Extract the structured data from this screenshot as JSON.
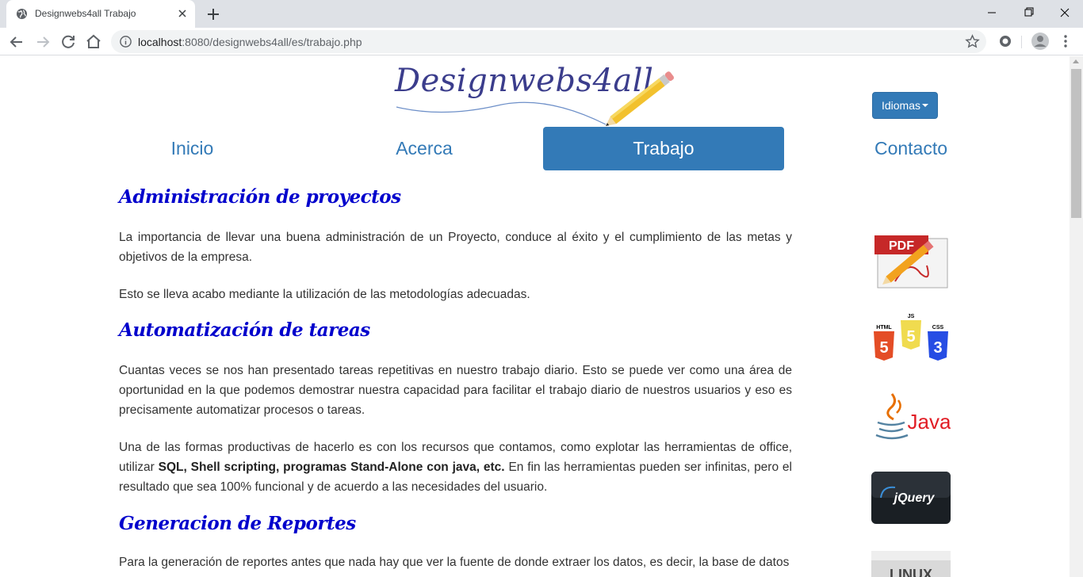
{
  "browser": {
    "tab_title": "Designwebs4all Trabajo",
    "url_host": "localhost",
    "url_path": ":8080/designwebs4all/es/trabajo.php"
  },
  "page": {
    "logo_text": "Designwebs4all",
    "language_button": "Idiomas",
    "nav": [
      {
        "label": "Inicio",
        "active": false
      },
      {
        "label": "Acerca",
        "active": false
      },
      {
        "label": "Trabajo",
        "active": true
      },
      {
        "label": "Contacto",
        "active": false
      }
    ],
    "sections": [
      {
        "title": "Administración de proyectos",
        "paragraphs": [
          "La importancia de llevar una buena administración de un Proyecto, conduce al éxito y el cumplimiento de las metas y objetivos de la empresa.",
          "Esto se lleva acabo mediante la utilización de las metodologías adecuadas."
        ]
      },
      {
        "title": "Automatización de tareas",
        "paragraphs": [
          "Cuantas veces se nos han presentado tareas repetitivas en nuestro trabajo diario. Esto se puede ver como una área de oportunidad en la que podemos demostrar nuestra capacidad para facilitar el trabajo diario de nuestros usuarios y eso es precisamente automatizar procesos o tareas."
        ],
        "rich_paragraph": {
          "before": "Una de las formas productivas de hacerlo es con los recursos que contamos, como explotar las herramientas de office, utilizar ",
          "bold": "SQL, Shell scripting, programas Stand-Alone con java, etc.",
          "after": " En fin las herramientas pueden ser infinitas, pero el resultado que sea 100% funcional y de acuerdo a las necesidades del usuario."
        }
      },
      {
        "title": "Generacion de Reportes",
        "paragraphs": [
          "Para la generación de reportes antes que nada hay que ver la fuente de donde extraer los datos, es decir, la base de datos"
        ]
      }
    ],
    "side_images": {
      "pdf_label": "PDF",
      "html_label": "HTML",
      "js_label": "JS",
      "css_label": "CSS",
      "html_num": "5",
      "js_num": "5",
      "css_num": "3",
      "java_label": "Java",
      "jquery_label": "jQuery",
      "linux_label": "LINUX"
    }
  }
}
